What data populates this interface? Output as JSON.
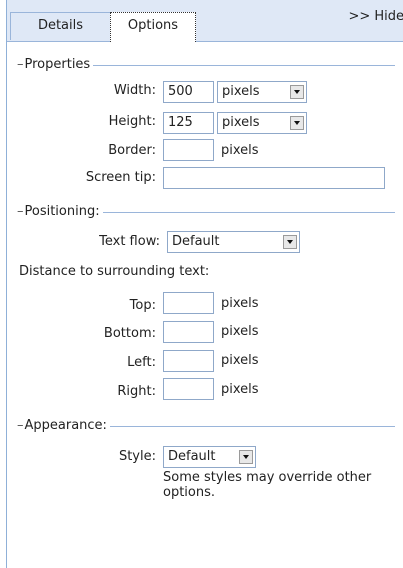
{
  "tabs": {
    "details": "Details",
    "options": "Options"
  },
  "hide_link": ">> Hide",
  "properties": {
    "title": "Properties",
    "width_label": "Width:",
    "width_value": "500",
    "width_unit": "pixels",
    "height_label": "Height:",
    "height_value": "125",
    "height_unit": "pixels",
    "border_label": "Border:",
    "border_value": "",
    "border_unit": "pixels",
    "screentip_label": "Screen tip:",
    "screentip_value": ""
  },
  "positioning": {
    "title": "Positioning:",
    "textflow_label": "Text flow:",
    "textflow_value": "Default",
    "distance_label": "Distance to surrounding text:",
    "top_label": "Top:",
    "bottom_label": "Bottom:",
    "left_label": "Left:",
    "right_label": "Right:",
    "unit": "pixels"
  },
  "appearance": {
    "title": "Appearance:",
    "style_label": "Style:",
    "style_value": "Default",
    "note": "Some styles may override other options."
  }
}
